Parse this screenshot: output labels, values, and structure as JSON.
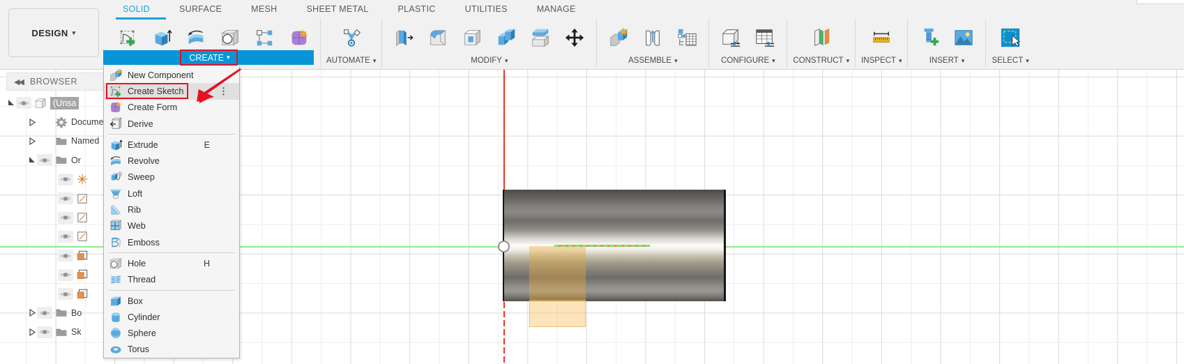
{
  "app": {
    "workspace_button": "DESIGN",
    "caret": "▾"
  },
  "ribbon": {
    "tabs": [
      {
        "label": "SOLID",
        "active": true
      },
      {
        "label": "SURFACE",
        "active": false
      },
      {
        "label": "MESH",
        "active": false
      },
      {
        "label": "SHEET METAL",
        "active": false
      },
      {
        "label": "PLASTIC",
        "active": false
      },
      {
        "label": "UTILITIES",
        "active": false
      },
      {
        "label": "MANAGE",
        "active": false
      }
    ],
    "panels": [
      {
        "label": "CREATE",
        "highlighted": true,
        "icons": [
          "create-sketch-icon",
          "extrude-icon",
          "revolve-icon",
          "hole-icon",
          "pattern-icon",
          "form-icon"
        ]
      },
      {
        "label": "AUTOMATE",
        "highlighted": false,
        "icons": [
          "automate-icon"
        ]
      },
      {
        "label": "MODIFY",
        "highlighted": false,
        "icons": [
          "press-pull-icon",
          "fillet-icon",
          "shell-icon",
          "combine-icon",
          "offset-face-icon",
          "move-copy-icon"
        ]
      },
      {
        "label": "ASSEMBLE",
        "highlighted": false,
        "icons": [
          "new-component-icon",
          "joint-icon",
          "assemble-table-icon"
        ]
      },
      {
        "label": "CONFIGURE",
        "highlighted": false,
        "icons": [
          "configure-body-icon",
          "configure-table-icon"
        ]
      },
      {
        "label": "CONSTRUCT",
        "highlighted": false,
        "icons": [
          "construct-plane-icon"
        ]
      },
      {
        "label": "INSPECT",
        "highlighted": false,
        "icons": [
          "measure-icon"
        ]
      },
      {
        "label": "INSERT",
        "highlighted": false,
        "icons": [
          "insert-mcmaster-icon",
          "insert-canvas-icon"
        ]
      },
      {
        "label": "SELECT",
        "highlighted": false,
        "icons": [
          "select-window-icon"
        ]
      }
    ],
    "accent_blue": "#0696D7",
    "highlight_red": "#E81123"
  },
  "create_menu": {
    "items": [
      {
        "label": "New Component",
        "icon": "new-component-icon",
        "shortcut": "",
        "highlighted": false,
        "overflow": false,
        "separator_after": false
      },
      {
        "label": "Create Sketch",
        "icon": "create-sketch-icon",
        "shortcut": "",
        "highlighted": true,
        "overflow": true,
        "separator_after": false
      },
      {
        "label": "Create Form",
        "icon": "create-form-icon",
        "shortcut": "",
        "highlighted": false,
        "overflow": false,
        "separator_after": false
      },
      {
        "label": "Derive",
        "icon": "derive-icon",
        "shortcut": "",
        "highlighted": false,
        "overflow": false,
        "separator_after": true
      },
      {
        "label": "Extrude",
        "icon": "extrude-icon",
        "shortcut": "E",
        "highlighted": false,
        "overflow": false,
        "separator_after": false
      },
      {
        "label": "Revolve",
        "icon": "revolve-icon",
        "shortcut": "",
        "highlighted": false,
        "overflow": false,
        "separator_after": false
      },
      {
        "label": "Sweep",
        "icon": "sweep-icon",
        "shortcut": "",
        "highlighted": false,
        "overflow": false,
        "separator_after": false
      },
      {
        "label": "Loft",
        "icon": "loft-icon",
        "shortcut": "",
        "highlighted": false,
        "overflow": false,
        "separator_after": false
      },
      {
        "label": "Rib",
        "icon": "rib-icon",
        "shortcut": "",
        "highlighted": false,
        "overflow": false,
        "separator_after": false
      },
      {
        "label": "Web",
        "icon": "web-icon",
        "shortcut": "",
        "highlighted": false,
        "overflow": false,
        "separator_after": false
      },
      {
        "label": "Emboss",
        "icon": "emboss-icon",
        "shortcut": "",
        "highlighted": false,
        "overflow": false,
        "separator_after": true
      },
      {
        "label": "Hole",
        "icon": "hole-icon",
        "shortcut": "H",
        "highlighted": false,
        "overflow": false,
        "separator_after": false
      },
      {
        "label": "Thread",
        "icon": "thread-icon",
        "shortcut": "",
        "highlighted": false,
        "overflow": false,
        "separator_after": true
      },
      {
        "label": "Box",
        "icon": "box-icon",
        "shortcut": "",
        "highlighted": false,
        "overflow": false,
        "separator_after": false
      },
      {
        "label": "Cylinder",
        "icon": "cylinder-icon",
        "shortcut": "",
        "highlighted": false,
        "overflow": false,
        "separator_after": false
      },
      {
        "label": "Sphere",
        "icon": "sphere-icon",
        "shortcut": "",
        "highlighted": false,
        "overflow": false,
        "separator_after": false
      },
      {
        "label": "Torus",
        "icon": "torus-icon",
        "shortcut": "",
        "highlighted": false,
        "overflow": false,
        "separator_after": false
      }
    ]
  },
  "browser": {
    "title": "BROWSER",
    "collapse_glyph": "◀◀",
    "rows": [
      {
        "label": "(Unsa",
        "icon": "body-cube-icon",
        "indent": 0,
        "twisty": "expanded",
        "eye": true,
        "selected": true
      },
      {
        "label": "Docume",
        "icon": "gear-icon",
        "indent": 1,
        "twisty": "collapsed",
        "eye": false,
        "selected": false
      },
      {
        "label": "Named",
        "icon": "folder-icon",
        "indent": 1,
        "twisty": "collapsed",
        "eye": false,
        "selected": false
      },
      {
        "label": "Or",
        "icon": "folder-icon",
        "indent": 1,
        "twisty": "expanded",
        "eye": true,
        "selected": false
      },
      {
        "label": "",
        "icon": "origin-point-icon",
        "indent": 2,
        "twisty": "none",
        "eye": true,
        "selected": false
      },
      {
        "label": "",
        "icon": "plane-icon",
        "indent": 2,
        "twisty": "none",
        "eye": true,
        "selected": false
      },
      {
        "label": "",
        "icon": "plane-icon",
        "indent": 2,
        "twisty": "none",
        "eye": true,
        "selected": false
      },
      {
        "label": "",
        "icon": "plane-icon",
        "indent": 2,
        "twisty": "none",
        "eye": true,
        "selected": false
      },
      {
        "label": "",
        "icon": "axis-icon",
        "indent": 2,
        "twisty": "none",
        "eye": true,
        "selected": false
      },
      {
        "label": "",
        "icon": "axis-icon",
        "indent": 2,
        "twisty": "none",
        "eye": true,
        "selected": false
      },
      {
        "label": "",
        "icon": "axis-icon",
        "indent": 2,
        "twisty": "none",
        "eye": true,
        "selected": false
      },
      {
        "label": "Bo",
        "icon": "folder-icon",
        "indent": 1,
        "twisty": "collapsed",
        "eye": true,
        "selected": false
      },
      {
        "label": "Sk",
        "icon": "folder-icon",
        "indent": 1,
        "twisty": "collapsed",
        "eye": true,
        "selected": false
      }
    ]
  },
  "viewport": {
    "model_name": "cylinder-body",
    "axis_x_color": "#8CEB8C",
    "axis_y_color": "#EE3322",
    "sketch_highlight_color": "#FABE5A",
    "origin_marker": "origin-circle"
  }
}
